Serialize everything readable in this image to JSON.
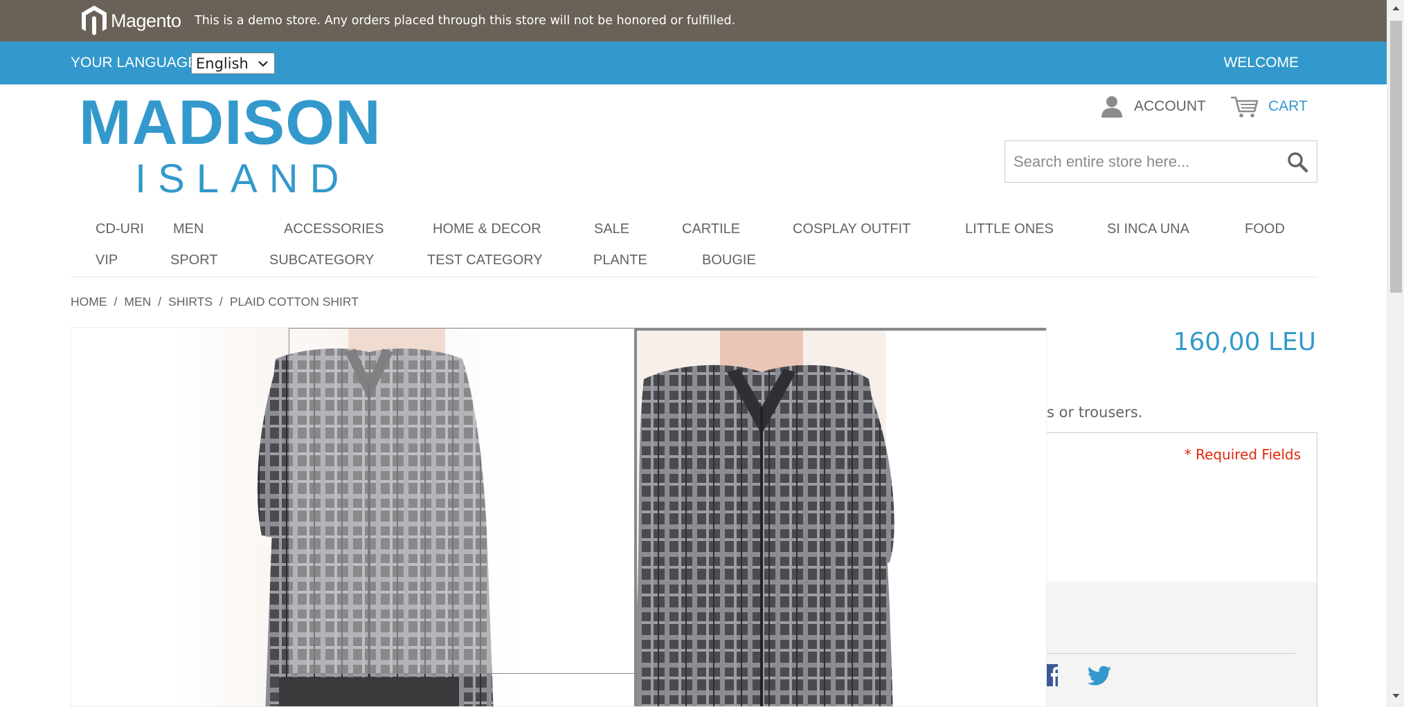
{
  "demo_notice": {
    "brand": "Magento",
    "text": "This is a demo store. Any orders placed through this store will not be honored or fulfilled."
  },
  "language_bar": {
    "label": "YOUR LANGUAGE:",
    "selected_language": "English",
    "welcome": "WELCOME"
  },
  "logo": {
    "top": "MADISON",
    "bottom": "ISLAND"
  },
  "header_links": {
    "account": "ACCOUNT",
    "cart": "CART"
  },
  "search": {
    "placeholder": "Search entire store here..."
  },
  "nav": {
    "row1": [
      "CD-URI",
      "MEN",
      "ACCESSORIES",
      "HOME & DECOR",
      "SALE",
      "CARTILE",
      "COSPLAY OUTFIT",
      "LITTLE ONES",
      "SI INCA UNA",
      "FOOD"
    ],
    "row2": [
      "VIP",
      "SPORT",
      "SUBCATEGORY",
      "TEST CATEGORY",
      "PLANTE",
      "BOUGIE"
    ]
  },
  "breadcrumb": [
    "HOME",
    "MEN",
    "SHIRTS",
    "PLAID COTTON SHIRT"
  ],
  "product": {
    "price": "160,00 LEU",
    "description_tail": "s or trousers.",
    "required_fields": "* Required Fields"
  },
  "icons": {
    "magento": "magento-logo-icon",
    "chevron": "chevron-down-icon",
    "account": "user-icon",
    "cart": "cart-icon",
    "search": "search-icon",
    "facebook": "facebook-icon",
    "twitter": "twitter-icon"
  },
  "colors": {
    "demo_bar": "#6a6158",
    "accent": "#3399cc",
    "required": "#df280a",
    "text": "#636363"
  }
}
